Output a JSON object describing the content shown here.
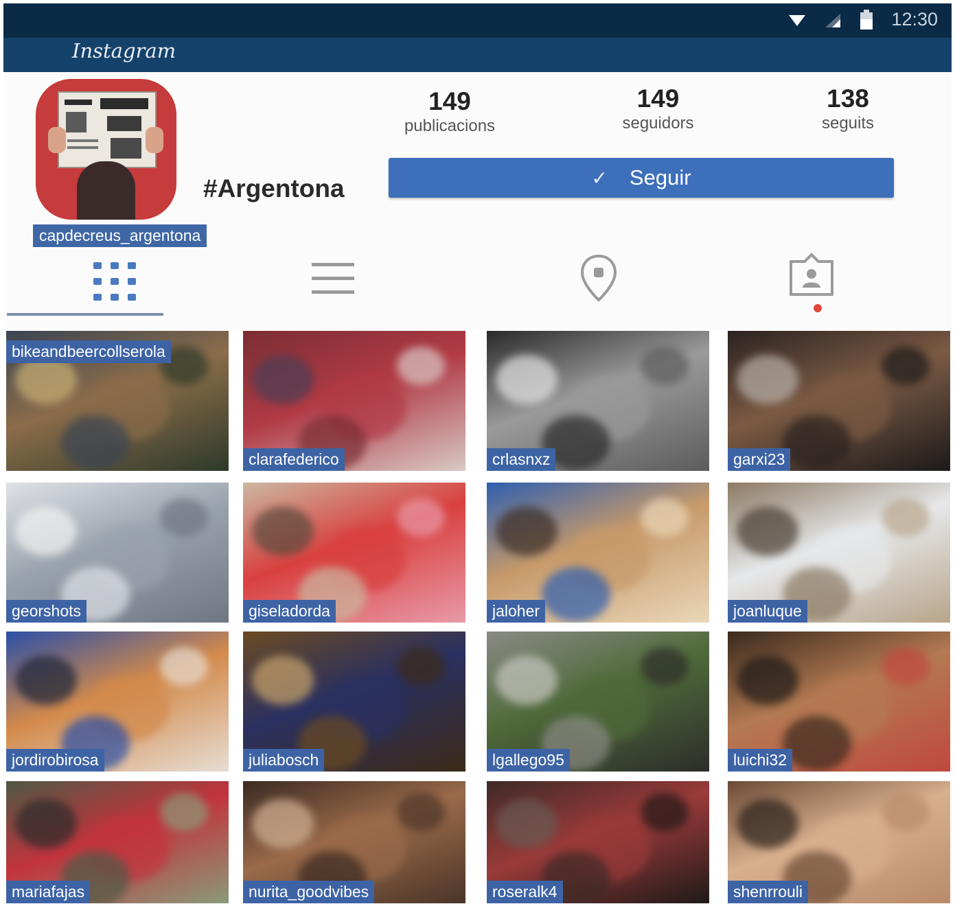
{
  "status_bar": {
    "time": "12:30",
    "icons": [
      "wifi-icon",
      "signal-icon",
      "battery-icon"
    ]
  },
  "app_bar": {
    "title": "Instagram"
  },
  "profile": {
    "username": "capdecreus_argentona",
    "hashtag": "#Argentona",
    "stats": [
      {
        "value": "149",
        "label": "publicacions"
      },
      {
        "value": "149",
        "label": "seguidors"
      },
      {
        "value": "138",
        "label": "seguits"
      }
    ],
    "follow_button": {
      "label": "Seguir",
      "icon": "check-icon"
    }
  },
  "tabs": [
    {
      "icon": "grid-icon",
      "selected": true
    },
    {
      "icon": "list-icon",
      "selected": false
    },
    {
      "icon": "location-pin-icon",
      "selected": false
    },
    {
      "icon": "tagged-person-icon",
      "selected": false
    }
  ],
  "grid": [
    {
      "username": "bikeandbeercollserola",
      "colors": [
        "#3a4452",
        "#8b6c4a",
        "#c9b074",
        "#2d3a2a"
      ]
    },
    {
      "username": "clarafederico",
      "colors": [
        "#7a2e33",
        "#b13a45",
        "#4a3e55",
        "#d8c9c4"
      ]
    },
    {
      "username": "crlasnxz",
      "colors": [
        "#2a2a2a",
        "#9a9a9a",
        "#e4e4e4",
        "#5c5c5c"
      ]
    },
    {
      "username": "garxi23",
      "colors": [
        "#2b2220",
        "#7b5a44",
        "#b8b0a8",
        "#1c1a1a"
      ]
    },
    {
      "username": "georshots",
      "colors": [
        "#dfe2e6",
        "#9aa3ad",
        "#f2f2f2",
        "#6f7782"
      ]
    },
    {
      "username": "giseladorda",
      "colors": [
        "#cbb8a2",
        "#d9403f",
        "#5a4a3c",
        "#e89aa8"
      ]
    },
    {
      "username": "jaloher",
      "colors": [
        "#2f5fb0",
        "#c79a6a",
        "#3d2e25",
        "#e9d7b9"
      ]
    },
    {
      "username": "joanluque",
      "colors": [
        "#8c7a63",
        "#e6e8ea",
        "#4a4034",
        "#b8a58a"
      ]
    },
    {
      "username": "jordirobirosa",
      "colors": [
        "#2a4fa8",
        "#d38a4b",
        "#1d2538",
        "#e6ddd3"
      ]
    },
    {
      "username": "juliabosch",
      "colors": [
        "#6b4a22",
        "#2a3060",
        "#c8a46a",
        "#3c2a18"
      ]
    },
    {
      "username": "lgallego95",
      "colors": [
        "#8a8a84",
        "#4f6a3a",
        "#c8c7c1",
        "#2d2d2a"
      ]
    },
    {
      "username": "luichi32",
      "colors": [
        "#3a2a1e",
        "#b47a52",
        "#1e1a18",
        "#c0483e"
      ]
    },
    {
      "username": "mariafajas",
      "colors": [
        "#4e5a44",
        "#c2333d",
        "#2a2a2a",
        "#8a9a7a"
      ]
    },
    {
      "username": "nurita_goodvibes",
      "colors": [
        "#3b2a22",
        "#9a6a4a",
        "#d2b296",
        "#4a3528"
      ]
    },
    {
      "username": "roseralk4",
      "colors": [
        "#3e2a26",
        "#9a3a3a",
        "#6a5a52",
        "#1f1a18"
      ]
    },
    {
      "username": "shenrrouli",
      "colors": [
        "#6b4a36",
        "#d8b08e",
        "#2b211c",
        "#b88a6a"
      ]
    }
  ]
}
